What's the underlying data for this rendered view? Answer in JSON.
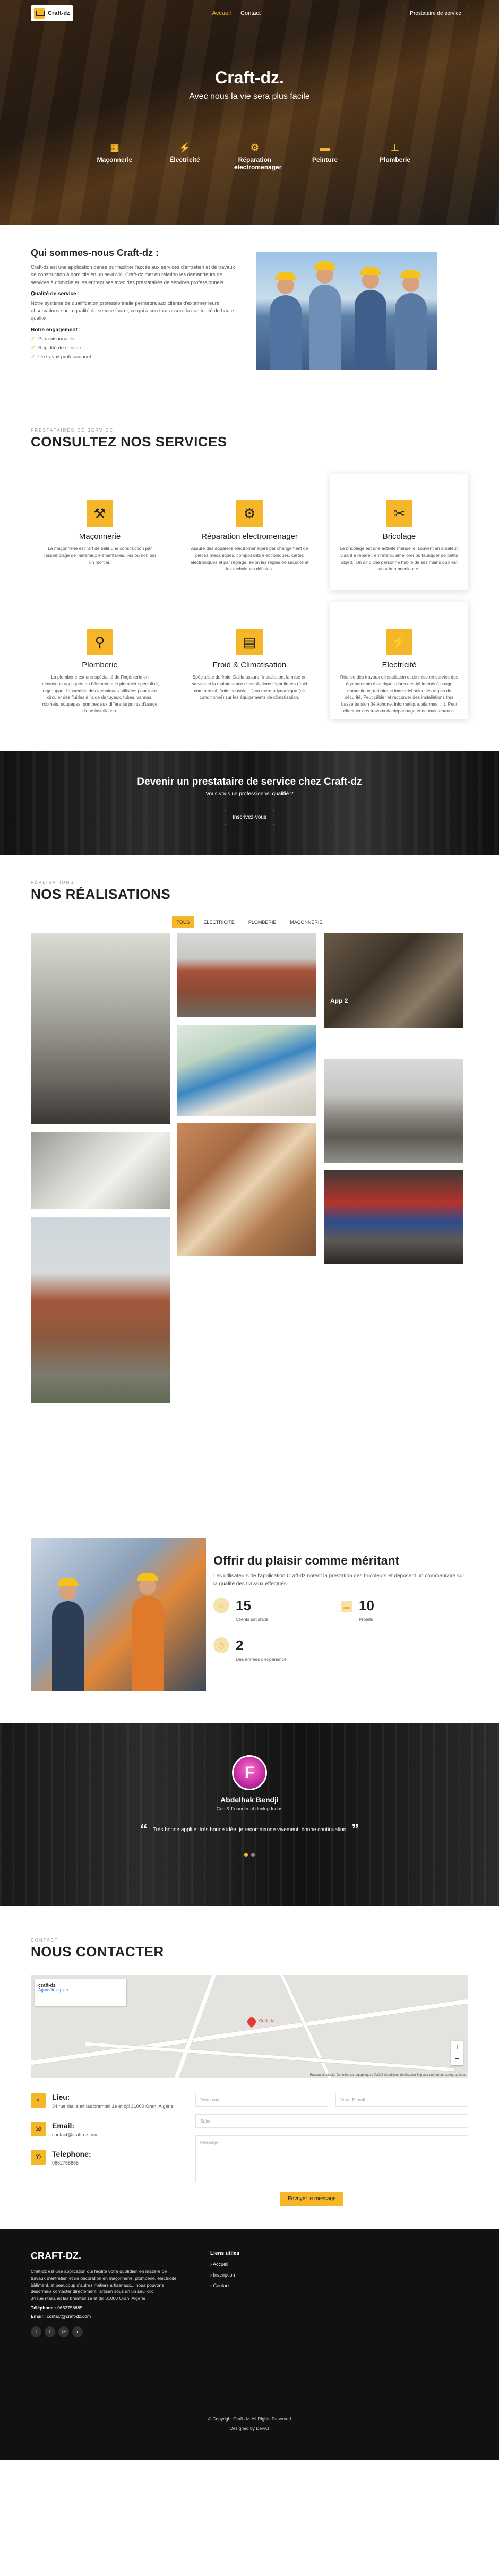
{
  "header": {
    "logo_text": "Craft-dz",
    "nav": [
      "Accueil",
      "Contact"
    ],
    "cta": "Prestataire de service"
  },
  "hero": {
    "title": "Craft-dz.",
    "subtitle": "Avec nous la vie sera plus facile",
    "categories": [
      "Maçonnerie",
      "Électricité",
      "Réparation electromenager",
      "Peinture",
      "Plomberie"
    ]
  },
  "about": {
    "title": "Qui sommes-nous Craft-dz :",
    "intro": "Craft-dz est une application pensé pur faciliter l'accès aux services d'entretien et de travaux de construction à domicile en un seul clic. Craft-dz met en relation les demandeurs de services à domicile et les entreprises avec des prestataires de services professionnels.",
    "quality_title": "Qualité de service :",
    "quality_text": "Notre système de qualification professionnelle permettra aux clients d'exprimer leurs observations sur la qualité du service fourni, ce qui à son tour assure la continuité de haute qualité",
    "commit_title": "Notre engagement :",
    "commitments": [
      "Prix raisonnable",
      "Rapidité de service",
      "Un travail professionnel"
    ]
  },
  "services": {
    "label": "Prestataires de service",
    "title": "CONSULTEZ NOS SERVICES",
    "items": [
      {
        "title": "Maçonnerie",
        "icon": "bricklayer-icon",
        "text": "La maçonnerie est l'art de bâtir une construction par l'assemblage de matériaux élémentaires, liés ou non par un mortier."
      },
      {
        "title": "Réparation electromenager",
        "icon": "repair-icon",
        "text": "Assure des appareils électroménagers par changement de pièces mécaniques, composants électroniques, cartes électroniques et par réglage, selon les règles de sécurité et les techniques définies."
      },
      {
        "title": "Bricolage",
        "icon": "tools-icon",
        "text": "Le bricolage est une activité manuelle, souvent en amateur, visant à réparer, entretenir, améliorer ou fabriquer de petits objets. On dit d'une personne habile de ses mains qu'il est un « bon bricoleur »."
      },
      {
        "title": "Plomberie",
        "icon": "plumbing-icon",
        "text": "La plomberie est une spécialité de l'ingénierie en mécanique appliquée au bâtiment et le plombier spécialisé, regroupant l'ensemble des techniques utilisées pour faire circuler des fluides à l'aide de tuyaux, tubes, vannes, robinets, soupapes, pompes aux différents points d'usage d'une installation."
      },
      {
        "title": "Froid & Climatisation",
        "icon": "ac-icon",
        "text": "Spécialiste du froid, Dalila assure l'installation, la mise en service et la maintenance d'installations frigorifiques (froid commercial, froid industriel…) ou thermodynamique (air conditionné) sur les équipements de climatisation."
      },
      {
        "title": "Electricité",
        "icon": "electricity-icon",
        "text": "Réalise des travaux d'installation et de mise en service des équipements électriques dans des bâtiments à usage domestique, tertiaire et industriel selon les règles de sécurité. Peut câbler et raccorder des installations très basse tension (téléphone, informatique, alarmes, ...). Peut effectuer des travaux de dépannage et de maintenance."
      }
    ]
  },
  "cta": {
    "title": "Devenir un prestataire de service chez Craft-dz",
    "text": "Vous vous un professionnel qualifié ?",
    "button": "Inscrivez-vous"
  },
  "works": {
    "label": "Réalisations",
    "title": "NOS RÉALISATIONS",
    "filters": [
      "TOUS",
      "ELECTRICITÉ",
      "PLOMBERIE",
      "MAÇONNERIE"
    ],
    "overlay": "App 2"
  },
  "achieve": {
    "title": "Offrir du plaisir comme méritant",
    "text": "Les utilisateurs de l'application Craft-dz notent la prestation des bricoleurs et déposent un commentaire sur la qualité des travaux effectués.",
    "stats": [
      {
        "value": "15",
        "label": "Clients satisfaits"
      },
      {
        "value": "10",
        "label": "Projets"
      },
      {
        "value": "2",
        "label": "Des années d'expérience"
      }
    ]
  },
  "testimonial": {
    "name": "Abdelhak Bendji",
    "role": "Ceo & Founder at devlop Indus",
    "quote": "Très bonne appli et très bonne idée, je recommande vivement, bonne continuation"
  },
  "contact": {
    "label": "Contact",
    "title": "NOUS CONTACTER",
    "map": {
      "place": "craft-dz",
      "link": "Agrandir le plan",
      "marker": "Craft dz",
      "terms": "Raccourcis clavier   Données cartographiques ©2023   Conditions d'utilisation   Signaler une erreur cartographique"
    },
    "address_title": "Lieu:",
    "address": "34 rue ritalia ait las bramtall 1e et djil 31000 Oran, Algérie",
    "email_title": "Email:",
    "email": "contact@craft-dz.com",
    "phone_title": "Telephone:",
    "phone": "0662758665",
    "form": {
      "name": "Votre nom",
      "email": "Votre E-mail",
      "subject": "Sujet",
      "message": "Message",
      "send": "Envoyer le message"
    }
  },
  "footer": {
    "title": "CRAFT-DZ.",
    "text": "Craft-dz est une application qui facilite votre quotidien en matière de travaux d'entretien et de décoration en maçonnerie, plomberie, électricité bâtiment, et beaucoup d'autres métiers artisanaux... nous pouvons désormais contacter directement l'artisan sous un un seul clic",
    "address": "34 rue ritalia ait las bramtall 1e et djil 31000 Oran, Algérie",
    "phone_label": "Téléphone :",
    "phone": "0662758665",
    "email_label": "Email :",
    "email": "contact@craft-dz.com",
    "links_title": "Liens utiles",
    "links": [
      "Accueil",
      "Inscription",
      "Contact"
    ],
    "copyright": "© Copyright Craft-dz. All Rights Reserved",
    "designed": "Designed by DevAz"
  },
  "colors": {
    "accent": "#f5b62a",
    "dark": "#111111"
  }
}
